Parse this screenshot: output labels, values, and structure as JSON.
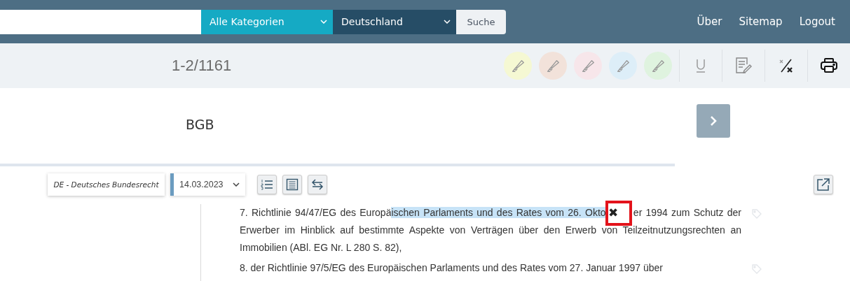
{
  "header": {
    "category_select": "Alle Kategorien",
    "country_select": "Deutschland",
    "search_button": "Suche",
    "links": [
      "Über",
      "Sitemap",
      "Logout"
    ]
  },
  "toolbar": {
    "hit_range": "1-2/1161",
    "highlighters": [
      {
        "color": "#f5f8d3"
      },
      {
        "color": "#f2e2da"
      },
      {
        "color": "#f7e6ea"
      },
      {
        "color": "#ddeef8"
      },
      {
        "color": "#dff3df"
      }
    ]
  },
  "document": {
    "title": "BGB",
    "source": "DE - Deutsches Bundesrecht",
    "date": "14.03.2023",
    "paragraphs": [
      {
        "lines": [
          [
            {
              "kind": "plain",
              "text": "7. Richtlinie 94/47/EG des Europä"
            },
            {
              "kind": "highlight",
              "text": "ischen Parlaments und des Rates vom 26. Okto"
            },
            {
              "kind": "marker",
              "text": "✖"
            },
            {
              "kind": "plain",
              "text": "er 1994 zum Schutz der"
            }
          ],
          [
            {
              "kind": "plain",
              "text": "Erwerber im Hinblick auf bestimmte Aspekte von Verträgen über den Erwerb von Teilzeitnutzungsrechten an"
            }
          ],
          [
            {
              "kind": "plain",
              "text": "Immobilien (ABl. EG Nr. L 280 S. 82),"
            }
          ]
        ]
      },
      {
        "lines": [
          [
            {
              "kind": "plain",
              "text": "8. der Richtlinie 97/5/EG des Europäischen Parlaments und des Rates vom 27. Januar 1997 über"
            }
          ]
        ]
      }
    ]
  }
}
